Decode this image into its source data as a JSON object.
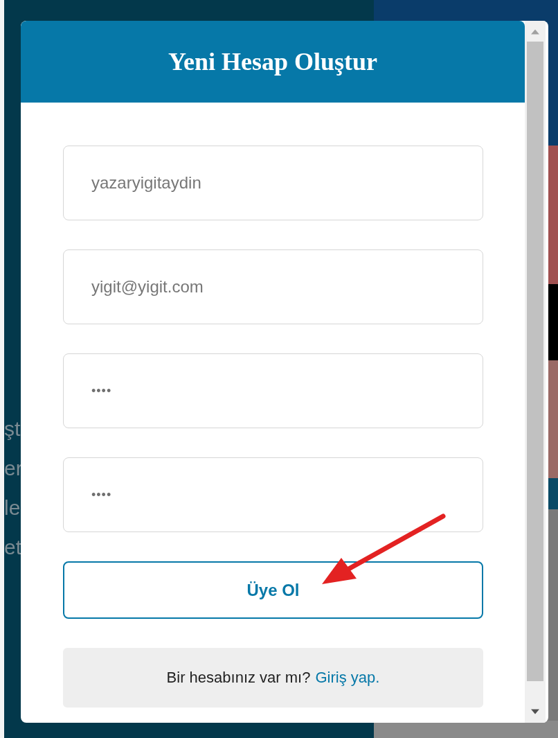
{
  "background": {
    "left_fragments": [
      {
        "text": "şt",
        "kind": "line"
      },
      {
        "text": "er",
        "kind": "line"
      },
      {
        "text": "le",
        "kind": "line"
      },
      {
        "text": "et",
        "kind": "line"
      }
    ]
  },
  "modal": {
    "title": "Yeni Hesap Oluştur",
    "fields": [
      {
        "kind": "text",
        "placeholder": "yazaryigitaydin"
      },
      {
        "kind": "text",
        "placeholder": "yigit@yigit.com"
      },
      {
        "kind": "password",
        "value": "••••"
      },
      {
        "kind": "password",
        "value": "••••"
      }
    ],
    "submit_button": "Üye Ol",
    "footer": {
      "text": "Bir hesabınız var mı?",
      "link": "Giriş yap."
    }
  }
}
